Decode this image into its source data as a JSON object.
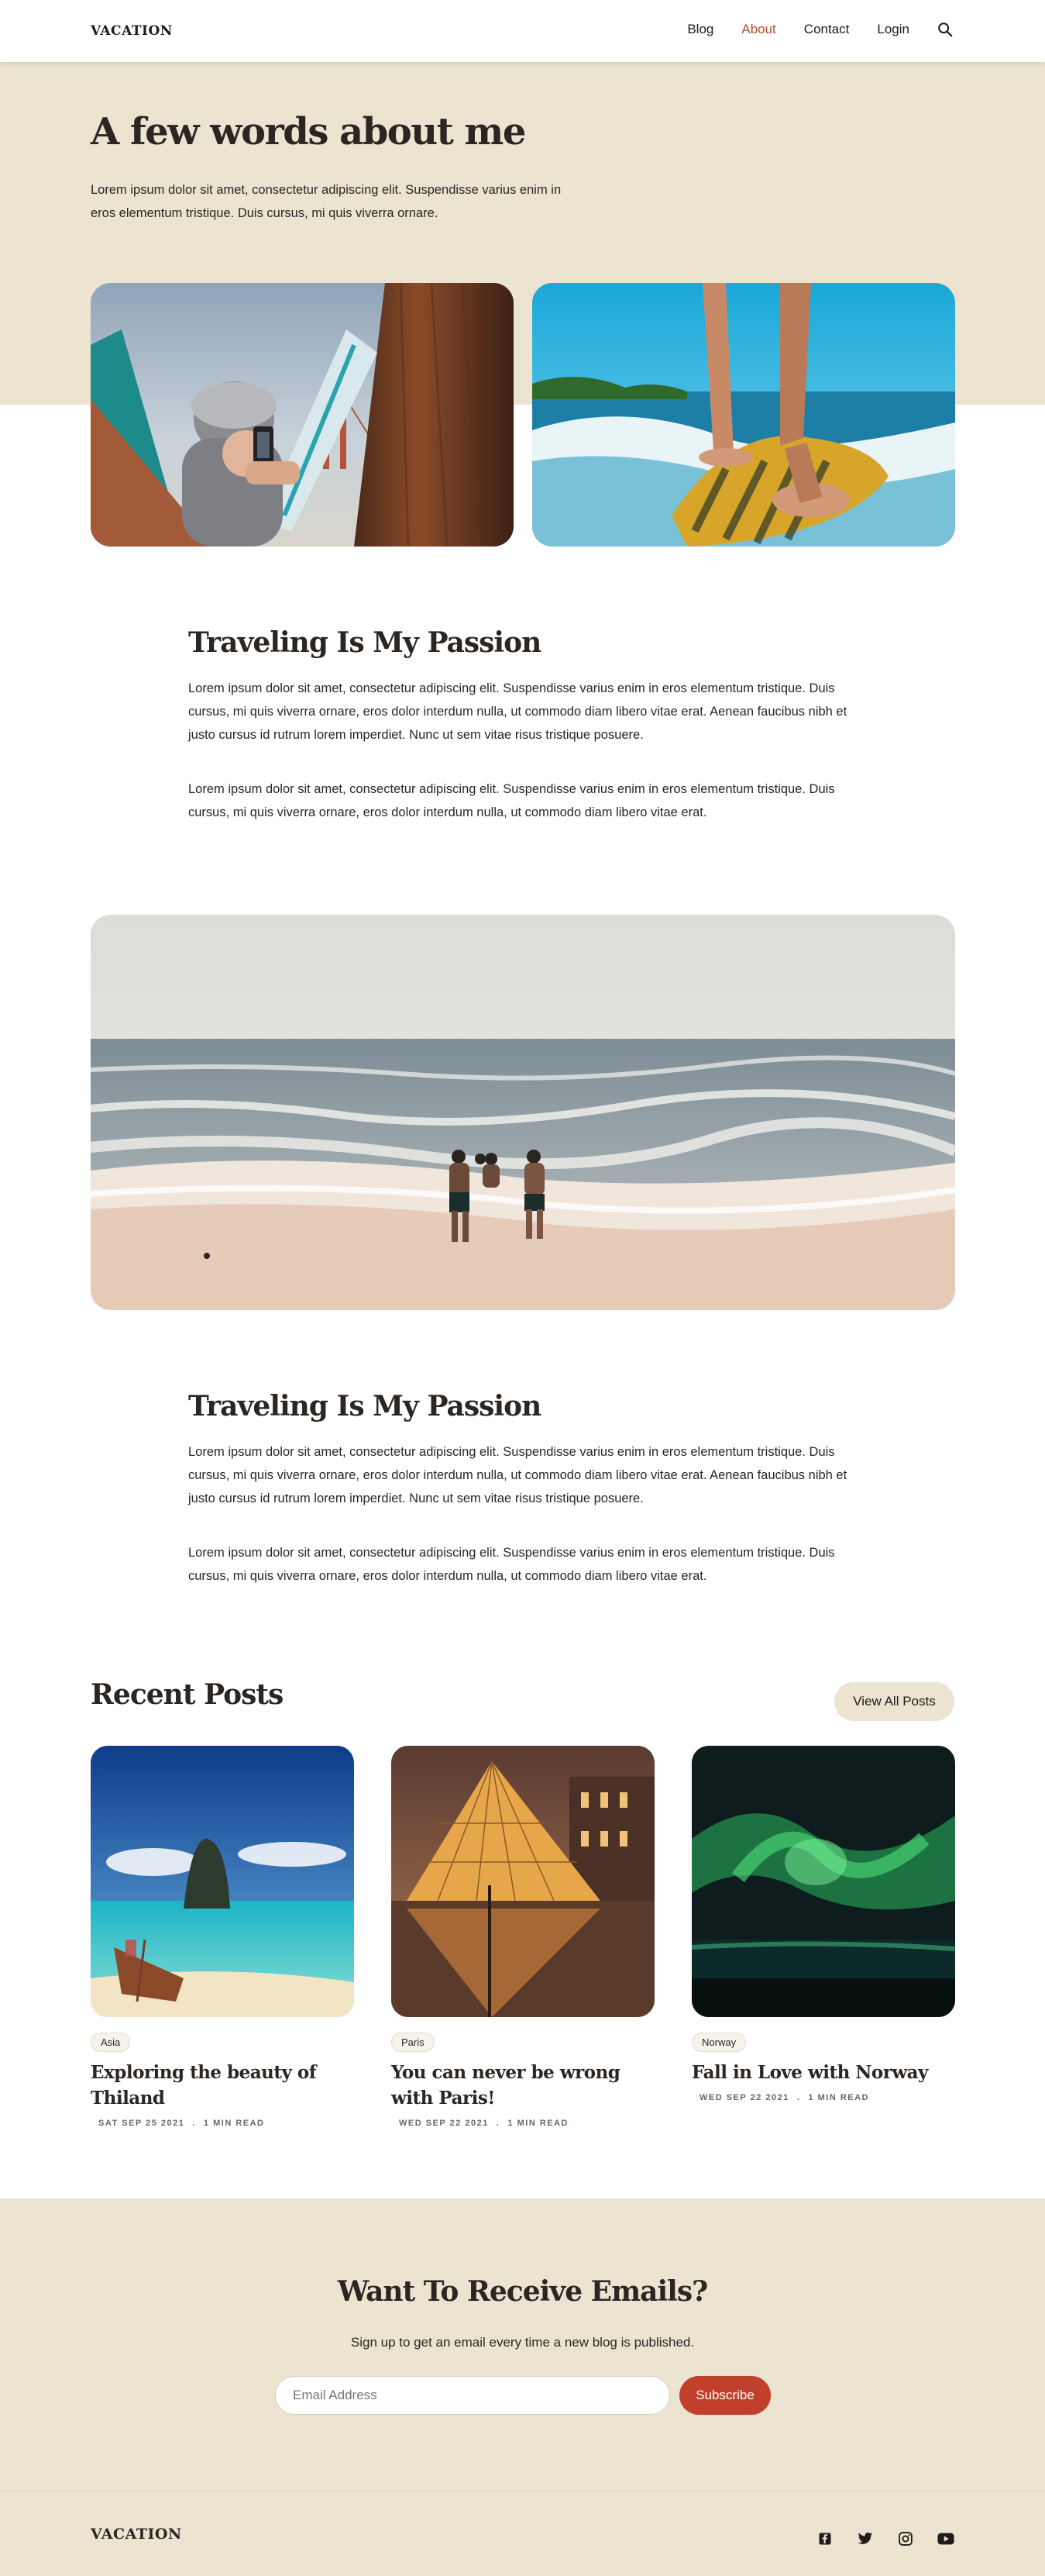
{
  "nav": {
    "brand": "VACATION",
    "links": [
      {
        "label": "Blog"
      },
      {
        "label": "About",
        "active": true
      },
      {
        "label": "Contact"
      },
      {
        "label": "Login"
      }
    ],
    "search_icon": "search-icon"
  },
  "hero": {
    "title": "A few words about me",
    "subtitle": "Lorem ipsum dolor sit amet, consectetur adipiscing elit. Suspendisse varius enim in eros elementum tristique. Duis cursus, mi quis viverra ornare."
  },
  "section1": {
    "title": "Traveling Is My Passion",
    "p1": "Lorem ipsum dolor sit amet, consectetur adipiscing elit. Suspendisse varius enim in eros elementum tristique. Duis cursus, mi quis viverra ornare, eros dolor interdum nulla, ut commodo diam libero vitae erat. Aenean faucibus nibh et justo cursus id rutrum lorem imperdiet. Nunc ut sem vitae risus tristique posuere.",
    "p2": "Lorem ipsum dolor sit amet, consectetur adipiscing elit. Suspendisse varius enim in eros elementum tristique. Duis cursus, mi quis viverra ornare, eros dolor interdum nulla, ut commodo diam libero vitae erat."
  },
  "section2": {
    "title": "Traveling Is My Passion",
    "p1": "Lorem ipsum dolor sit amet, consectetur adipiscing elit. Suspendisse varius enim in eros elementum tristique. Duis cursus, mi quis viverra ornare, eros dolor interdum nulla, ut commodo diam libero vitae erat. Aenean faucibus nibh et justo cursus id rutrum lorem imperdiet. Nunc ut sem vitae risus tristique posuere.",
    "p2": "Lorem ipsum dolor sit amet, consectetur adipiscing elit. Suspendisse varius enim in eros elementum tristique. Duis cursus, mi quis viverra ornare, eros dolor interdum nulla, ut commodo diam libero vitae erat."
  },
  "recent": {
    "title": "Recent Posts",
    "view_all": "View All Posts",
    "posts": [
      {
        "tag": "Asia",
        "title": "Exploring the beauty of Thiland",
        "date": "SAT SEP 25 2021",
        "read": "1 MIN READ"
      },
      {
        "tag": "Paris",
        "title": "You can never be wrong with Paris!",
        "date": "WED SEP 22 2021",
        "read": "1 MIN READ"
      },
      {
        "tag": "Norway",
        "title": "Fall in Love with Norway",
        "date": "WED SEP 22 2021",
        "read": "1 MIN READ"
      }
    ]
  },
  "newsletter": {
    "title": "Want To Receive Emails?",
    "subtitle": "Sign up to get an email every time a new blog is published.",
    "email_placeholder": "Email Address",
    "button": "Subscribe"
  },
  "footer": {
    "brand": "VACATION",
    "socials": [
      "facebook-icon",
      "twitter-icon",
      "instagram-icon",
      "youtube-icon"
    ]
  },
  "colors": {
    "beige": "#ece3d1",
    "accent": "#c0402c",
    "text": "#2b2622"
  }
}
